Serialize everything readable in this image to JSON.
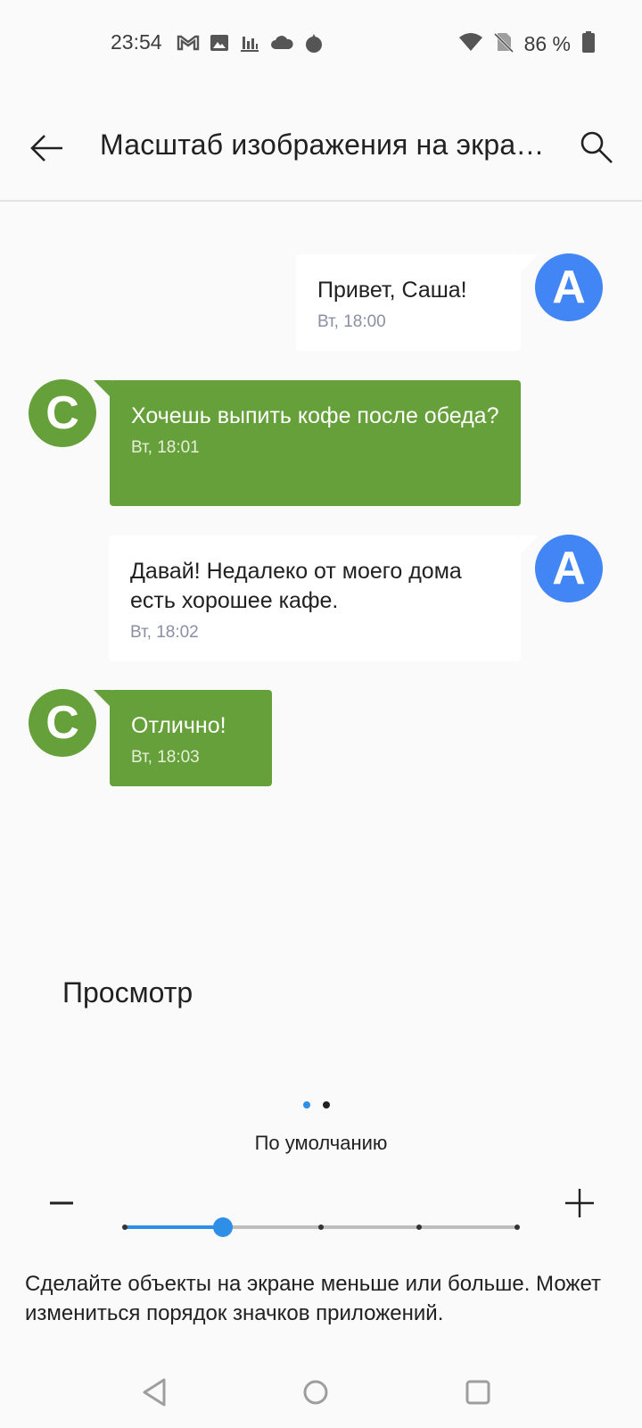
{
  "status_bar": {
    "time": "23:54",
    "battery": "86 %",
    "left_icons": [
      "gmail-icon",
      "image-icon",
      "chart-icon",
      "cloud-icon",
      "flame-icon"
    ],
    "right_icons": [
      "wifi-icon",
      "no-sim-icon",
      "battery-icon"
    ]
  },
  "app_bar": {
    "title": "Масштаб изображения на экране"
  },
  "messages": [
    {
      "sender": "A",
      "direction": "out",
      "text": "Привет, Саша!",
      "time": "Вт, 18:00"
    },
    {
      "sender": "C",
      "direction": "in",
      "text": "Хочешь выпить кофе после обеда?",
      "time": "Вт, 18:01"
    },
    {
      "sender": "A",
      "direction": "out",
      "text": "Давай! Недалеко от моего дома есть хорошее кафе.",
      "time": "Вт, 18:02"
    },
    {
      "sender": "C",
      "direction": "in",
      "text": "Отлично!",
      "time": "Вт, 18:03"
    }
  ],
  "preview": {
    "label": "Просмотр",
    "page_count": 2,
    "current_page": 1
  },
  "scale": {
    "label": "По умолчанию",
    "steps": 5,
    "current_step": 2,
    "description": "Сделайте объекты на экране меньше или больше. Может измениться порядок значков приложений."
  },
  "colors": {
    "accent": "#2f8ee6",
    "avatar_a": "#4285f4",
    "avatar_c": "#66a03a",
    "bubble_in": "#66a03a",
    "bubble_out": "#ffffff"
  }
}
